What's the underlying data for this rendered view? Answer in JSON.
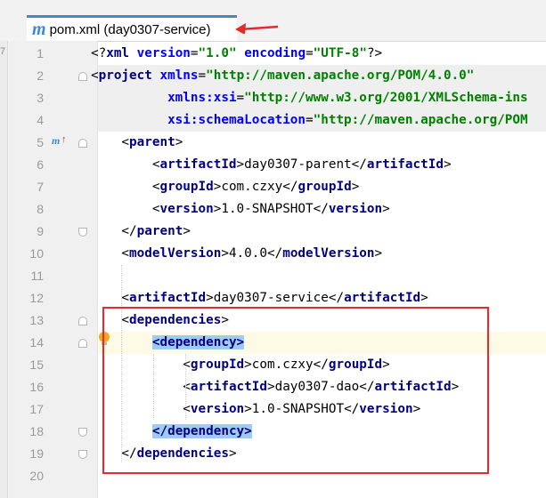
{
  "tab": {
    "title": "pom.xml (day0307-service)",
    "icon": "maven-m-icon"
  },
  "side_stub_text": "7",
  "colors": {
    "accent": "#4d83c8",
    "annotation_red": "#e32b2b",
    "tag": "#000080",
    "attr": "#0000ff",
    "value": "#008000"
  },
  "lines": [
    {
      "n": "1",
      "segs": [
        [
          "br",
          "<?"
        ],
        [
          "tag",
          "xml "
        ],
        [
          "attr",
          "version"
        ],
        [
          "br",
          "="
        ],
        [
          "val",
          "\"1.0\""
        ],
        [
          "br",
          " "
        ],
        [
          "attr",
          "encoding"
        ],
        [
          "br",
          "="
        ],
        [
          "val",
          "\"UTF-8\""
        ],
        [
          "br",
          "?>"
        ]
      ]
    },
    {
      "n": "2",
      "segs": [
        [
          "br",
          "<"
        ],
        [
          "tag",
          "project "
        ],
        [
          "attr",
          "xmlns"
        ],
        [
          "br",
          "="
        ],
        [
          "val",
          "\"http://maven.apache.org/POM/4.0.0\""
        ]
      ]
    },
    {
      "n": "3",
      "segs": [
        [
          "br",
          "          "
        ],
        [
          "attr",
          "xmlns:xsi"
        ],
        [
          "br",
          "="
        ],
        [
          "val",
          "\"http://www.w3.org/2001/XMLSchema-ins"
        ]
      ]
    },
    {
      "n": "4",
      "segs": [
        [
          "br",
          "          "
        ],
        [
          "attr",
          "xsi:schemaLocation"
        ],
        [
          "br",
          "="
        ],
        [
          "val",
          "\"http://maven.apache.org/POM"
        ]
      ]
    },
    {
      "n": "5",
      "segs": [
        [
          "br",
          "    <"
        ],
        [
          "tag",
          "parent"
        ],
        [
          "br",
          ">"
        ]
      ]
    },
    {
      "n": "6",
      "segs": [
        [
          "br",
          "        <"
        ],
        [
          "tag",
          "artifactId"
        ],
        [
          "br",
          ">"
        ],
        [
          "txt",
          "day0307-parent"
        ],
        [
          "br",
          "</"
        ],
        [
          "tag",
          "artifactId"
        ],
        [
          "br",
          ">"
        ]
      ]
    },
    {
      "n": "7",
      "segs": [
        [
          "br",
          "        <"
        ],
        [
          "tag",
          "groupId"
        ],
        [
          "br",
          ">"
        ],
        [
          "txt",
          "com.czxy"
        ],
        [
          "br",
          "</"
        ],
        [
          "tag",
          "groupId"
        ],
        [
          "br",
          ">"
        ]
      ]
    },
    {
      "n": "8",
      "segs": [
        [
          "br",
          "        <"
        ],
        [
          "tag",
          "version"
        ],
        [
          "br",
          ">"
        ],
        [
          "txt",
          "1.0-SNAPSHOT"
        ],
        [
          "br",
          "</"
        ],
        [
          "tag",
          "version"
        ],
        [
          "br",
          ">"
        ]
      ]
    },
    {
      "n": "9",
      "segs": [
        [
          "br",
          "    </"
        ],
        [
          "tag",
          "parent"
        ],
        [
          "br",
          ">"
        ]
      ]
    },
    {
      "n": "10",
      "segs": [
        [
          "br",
          "    <"
        ],
        [
          "tag",
          "modelVersion"
        ],
        [
          "br",
          ">"
        ],
        [
          "txt",
          "4.0.0"
        ],
        [
          "br",
          "</"
        ],
        [
          "tag",
          "modelVersion"
        ],
        [
          "br",
          ">"
        ]
      ]
    },
    {
      "n": "11",
      "segs": []
    },
    {
      "n": "12",
      "segs": [
        [
          "br",
          "    <"
        ],
        [
          "tag",
          "artifactId"
        ],
        [
          "br",
          ">"
        ],
        [
          "txt",
          "day0307-service"
        ],
        [
          "br",
          "</"
        ],
        [
          "tag",
          "artifactId"
        ],
        [
          "br",
          ">"
        ]
      ]
    },
    {
      "n": "13",
      "segs": [
        [
          "br",
          "    <"
        ],
        [
          "tag",
          "dependencies"
        ],
        [
          "br",
          ">"
        ]
      ]
    },
    {
      "n": "14",
      "segs": [
        [
          "br",
          "        "
        ],
        [
          "dtag",
          "<dependency>"
        ]
      ]
    },
    {
      "n": "15",
      "segs": [
        [
          "br",
          "            <"
        ],
        [
          "tag",
          "groupId"
        ],
        [
          "br",
          ">"
        ],
        [
          "txt",
          "com.czxy"
        ],
        [
          "br",
          "</"
        ],
        [
          "tag",
          "groupId"
        ],
        [
          "br",
          ">"
        ]
      ]
    },
    {
      "n": "16",
      "segs": [
        [
          "br",
          "            <"
        ],
        [
          "tag",
          "artifactId"
        ],
        [
          "br",
          ">"
        ],
        [
          "txt",
          "day0307-dao"
        ],
        [
          "br",
          "</"
        ],
        [
          "tag",
          "artifactId"
        ],
        [
          "br",
          ">"
        ]
      ]
    },
    {
      "n": "17",
      "segs": [
        [
          "br",
          "            <"
        ],
        [
          "tag",
          "version"
        ],
        [
          "br",
          ">"
        ],
        [
          "txt",
          "1.0-SNAPSHOT"
        ],
        [
          "br",
          "</"
        ],
        [
          "tag",
          "version"
        ],
        [
          "br",
          ">"
        ]
      ]
    },
    {
      "n": "18",
      "segs": [
        [
          "br",
          "        "
        ],
        [
          "dtag",
          "</dependency>"
        ]
      ]
    },
    {
      "n": "19",
      "segs": [
        [
          "br",
          "    </"
        ],
        [
          "tag",
          "dependencies"
        ],
        [
          "br",
          ">"
        ]
      ]
    },
    {
      "n": "20",
      "segs": []
    }
  ]
}
